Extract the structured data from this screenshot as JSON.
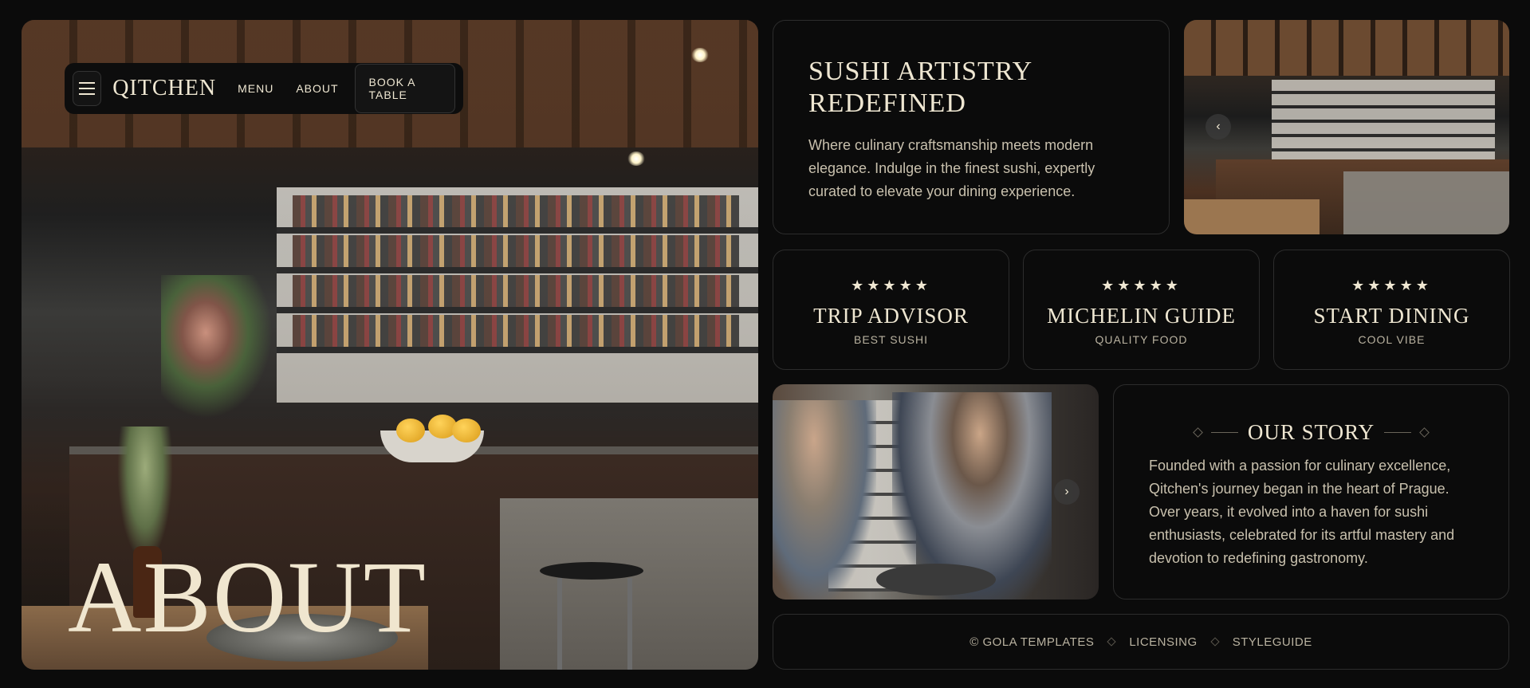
{
  "nav": {
    "brand": "QITCHEN",
    "links": [
      "MENU",
      "ABOUT"
    ],
    "cta": "BOOK A TABLE"
  },
  "hero": {
    "title": "ABOUT"
  },
  "intro": {
    "heading": "SUSHI ARTISTRY REDEFINED",
    "body": "Where culinary craftsmanship meets modern elegance. Indulge in the finest sushi, expertly curated to elevate your dining experience."
  },
  "stats": [
    {
      "stars": "★★★★★",
      "title": "TRIP ADVISOR",
      "subtitle": "BEST SUSHI"
    },
    {
      "stars": "★★★★★",
      "title": "MICHELIN GUIDE",
      "subtitle": "QUALITY FOOD"
    },
    {
      "stars": "★★★★★",
      "title": "START DINING",
      "subtitle": "COOL VIBE"
    }
  ],
  "story": {
    "heading": "OUR STORY",
    "body": "Founded with a passion for culinary excellence, Qitchen's journey began in the heart of Prague. Over years, it evolved into a haven for sushi enthusiasts, celebrated for its artful mastery and devotion to redefining gastronomy."
  },
  "footer": {
    "items": [
      "© GOLA TEMPLATES",
      "LICENSING",
      "STYLEGUIDE"
    ]
  },
  "icons": {
    "menu": "hamburger-icon",
    "prev": "chevron-left-icon",
    "next": "chevron-right-icon",
    "separator": "diamond-icon"
  },
  "colors": {
    "background": "#0b0b0b",
    "text": "#efe7d2",
    "muted": "#c8c0ad",
    "border": "#2c2c2c"
  }
}
